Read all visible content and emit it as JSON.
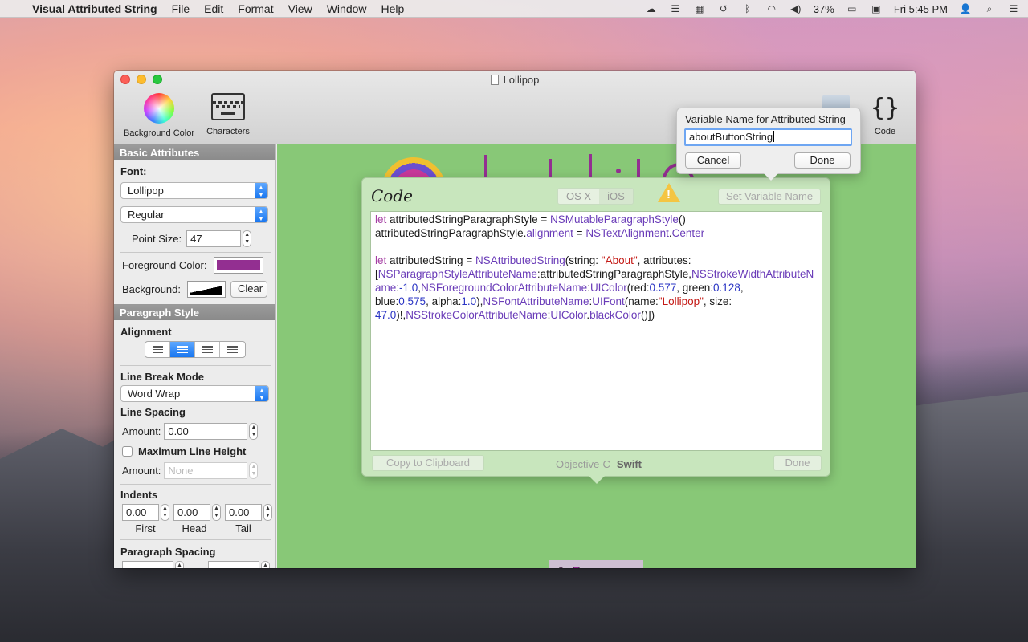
{
  "menubar": {
    "app_name": "Visual Attributed String",
    "menus": [
      "File",
      "Edit",
      "Format",
      "View",
      "Window",
      "Help"
    ],
    "battery": "37%",
    "clock": "Fri 5:45 PM"
  },
  "window": {
    "title": "Lollipop",
    "toolbar": {
      "background_color_label": "Background Color",
      "characters_label": "Characters",
      "code_label": "Code"
    }
  },
  "sidebar": {
    "basic_attributes_header": "Basic Attributes",
    "font_label": "Font:",
    "font_family": "Lollipop",
    "font_style": "Regular",
    "point_size_label": "Point Size:",
    "point_size": "47",
    "foreground_color_label": "Foreground Color:",
    "foreground_color": "#932f91",
    "background_label": "Background:",
    "clear_label": "Clear",
    "paragraph_style_header": "Paragraph Style",
    "alignment_label": "Alignment",
    "line_break_mode_label": "Line Break Mode",
    "line_break_mode": "Word Wrap",
    "line_spacing_label": "Line Spacing",
    "amount_label": "Amount:",
    "line_spacing_amount": "0.00",
    "max_line_height_label": "Maximum Line Height",
    "max_amount_label": "Amount:",
    "max_amount_placeholder": "None",
    "indents_label": "Indents",
    "indent_first": "0.00",
    "indent_head": "0.00",
    "indent_tail": "0.00",
    "first_label": "First",
    "head_label": "Head",
    "tail_label": "Tail",
    "paragraph_spacing_label": "Paragraph Spacing"
  },
  "canvas": {
    "sample_text": "About",
    "background_color": "#88c877"
  },
  "code_popover": {
    "title": "Code",
    "os_x_label": "OS X",
    "ios_label": "iOS",
    "set_variable_name_label": "Set Variable Name",
    "copy_label": "Copy to Clipboard",
    "objc_label": "Objective-C",
    "swift_label": "Swift",
    "done_label": "Done",
    "code": {
      "l1_kw": "let",
      "l1_a": " attributedStringParagraphStyle = ",
      "l1_cls": "NSMutableParagraphStyle",
      "l1_b": "()",
      "l2_a": "attributedStringParagraphStyle.",
      "l2_prop": "alignment",
      "l2_b": " = ",
      "l2_cls": "NSTextAlignment",
      "l2_c": ".",
      "l2_case": "Center",
      "l3_kw": "let",
      "l3_a": " attributedString = ",
      "l3_cls": "NSAttributedString",
      "l3_b": "(string: ",
      "l3_str": "\"About\"",
      "l3_c": ", attributes:",
      "l4_a": "[",
      "l4_cls1": "NSParagraphStyleAttributeName",
      "l4_b": ":attributedStringParagraphStyle,",
      "l4_cls2": "NSStrokeWidthAttributeName",
      "l4_c": ":",
      "l4_num1": "-1.0",
      "l4_d": ",",
      "l4_cls3": "NSForegroundColorAttributeName",
      "l4_e": ":",
      "l4_cls4": "UIColor",
      "l4_f": "(red:",
      "l4_num2": "0.577",
      "l4_g": ", green:",
      "l4_num3": "0.128",
      "l4_h": ",",
      "l5_a": "blue:",
      "l5_num1": "0.575",
      "l5_b": ", alpha:",
      "l5_num2": "1.0",
      "l5_c": "),",
      "l5_cls1": "NSFontAttributeName",
      "l5_d": ":",
      "l5_cls2": "UIFont",
      "l5_e": "(name:",
      "l5_str": "\"Lollipop\"",
      "l5_f": ", size:",
      "l6_num": "47.0",
      "l6_a": ")!,",
      "l6_cls1": "NSStrokeColorAttributeName",
      "l6_b": ":",
      "l6_cls2": "UIColor",
      "l6_c": ".",
      "l6_m": "blackColor",
      "l6_d": "()])"
    }
  },
  "variable_popover": {
    "title": "Variable Name for Attributed String",
    "value": "aboutButtonString",
    "cancel_label": "Cancel",
    "done_label": "Done"
  }
}
